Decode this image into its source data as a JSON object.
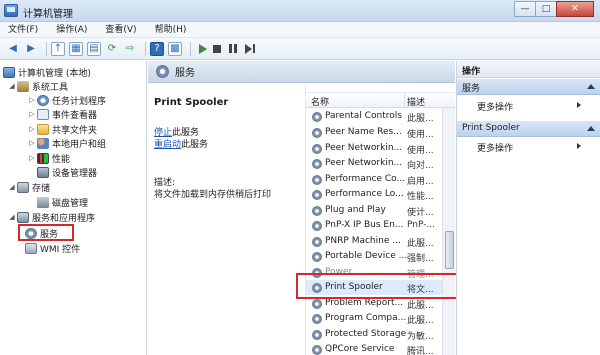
{
  "window": {
    "title": "计算机管理"
  },
  "menubar": {
    "items": [
      "文件(F)",
      "操作(A)",
      "查看(V)",
      "帮助(H)"
    ]
  },
  "tree": {
    "root": "计算机管理 (本地)",
    "system_tools": "系统工具",
    "task_scheduler": "任务计划程序",
    "event_viewer": "事件查看器",
    "shared_folders": "共享文件夹",
    "local_users": "本地用户和组",
    "performance": "性能",
    "device_manager": "设备管理器",
    "storage": "存储",
    "disk_management": "磁盘管理",
    "services_apps": "服务和应用程序",
    "services": "服务",
    "wmi": "WMI 控件"
  },
  "middle": {
    "header_title": "服务",
    "selected_service": "Print Spooler",
    "stop_link": "停止",
    "stop_suffix": "此服务",
    "restart_link": "重启动",
    "restart_suffix": "此服务",
    "desc_label": "描述:",
    "desc_text": "将文件加载到内存供稍后打印"
  },
  "list": {
    "col_name": "名称",
    "col_desc": "描述",
    "rows": [
      {
        "name": "Parental Controls",
        "desc": "此服..."
      },
      {
        "name": "Peer Name Res...",
        "desc": "使用..."
      },
      {
        "name": "Peer Networkin...",
        "desc": "使用..."
      },
      {
        "name": "Peer Networkin...",
        "desc": "向对..."
      },
      {
        "name": "Performance Co...",
        "desc": "启用..."
      },
      {
        "name": "Performance Lo...",
        "desc": "性能..."
      },
      {
        "name": "Plug and Play",
        "desc": "使计..."
      },
      {
        "name": "PnP-X IP Bus En...",
        "desc": "PnP-..."
      },
      {
        "name": "PNRP Machine ...",
        "desc": "此服..."
      },
      {
        "name": "Portable Device ...",
        "desc": "强制..."
      },
      {
        "name": "Power",
        "desc": "管理..."
      },
      {
        "name": "Print Spooler",
        "desc": "将文..."
      },
      {
        "name": "Problem Report...",
        "desc": "此服..."
      },
      {
        "name": "Program Compa...",
        "desc": "此服..."
      },
      {
        "name": "Protected Storage",
        "desc": "为敏..."
      },
      {
        "name": "QPCore Service",
        "desc": "腾讯..."
      }
    ]
  },
  "actions": {
    "header": "操作",
    "section1": "服务",
    "section1_more": "更多操作",
    "section2": "Print Spooler",
    "section2_more": "更多操作"
  },
  "colors": {
    "highlight_box": "#d9262c",
    "selection": "#dcebfc",
    "link": "#1a54b8"
  }
}
